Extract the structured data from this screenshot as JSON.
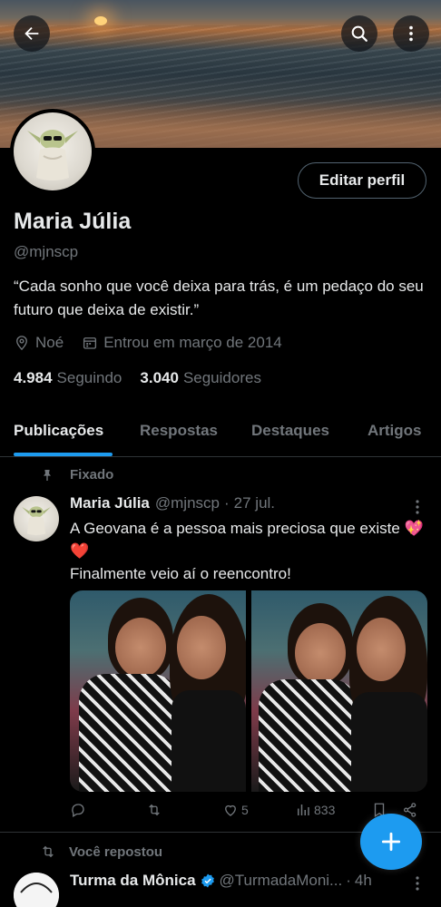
{
  "profile": {
    "name": "Maria Júlia",
    "handle": "@mjnscp",
    "bio": "“Cada sonho que você deixa para trás, é um pedaço do seu futuro que deixa de existir.”",
    "location": "Noé",
    "joined": "Entrou em março de 2014",
    "following_count": "4.984",
    "following_label": "Seguindo",
    "followers_count": "3.040",
    "followers_label": "Seguidores",
    "edit_label": "Editar perfil"
  },
  "tabs": [
    {
      "label": "Publicações",
      "active": true
    },
    {
      "label": "Respostas",
      "active": false
    },
    {
      "label": "Destaques",
      "active": false
    },
    {
      "label": "Artigos",
      "active": false
    }
  ],
  "pinned_tweet": {
    "pinned_label": "Fixado",
    "author_name": "Maria Júlia",
    "author_handle": "@mjnscp",
    "sep": "·",
    "date": "27 jul.",
    "text_line1": "A Geovana é a pessoa mais preciosa que existe 💖❤️",
    "text_line2": "Finalmente veio aí o reencontro!",
    "replies": "",
    "reposts": "",
    "likes": "5",
    "views": "833"
  },
  "retweet": {
    "repost_label": "Você repostou",
    "author_name": "Turma da Mônica",
    "author_handle": "@TurmadaMoni...",
    "time": "4h",
    "sep": "·"
  },
  "colors": {
    "accent": "#1d9bf0",
    "background": "#000000",
    "muted_text": "#71767b",
    "border": "#2f3336",
    "like_heart": "#f91880"
  }
}
